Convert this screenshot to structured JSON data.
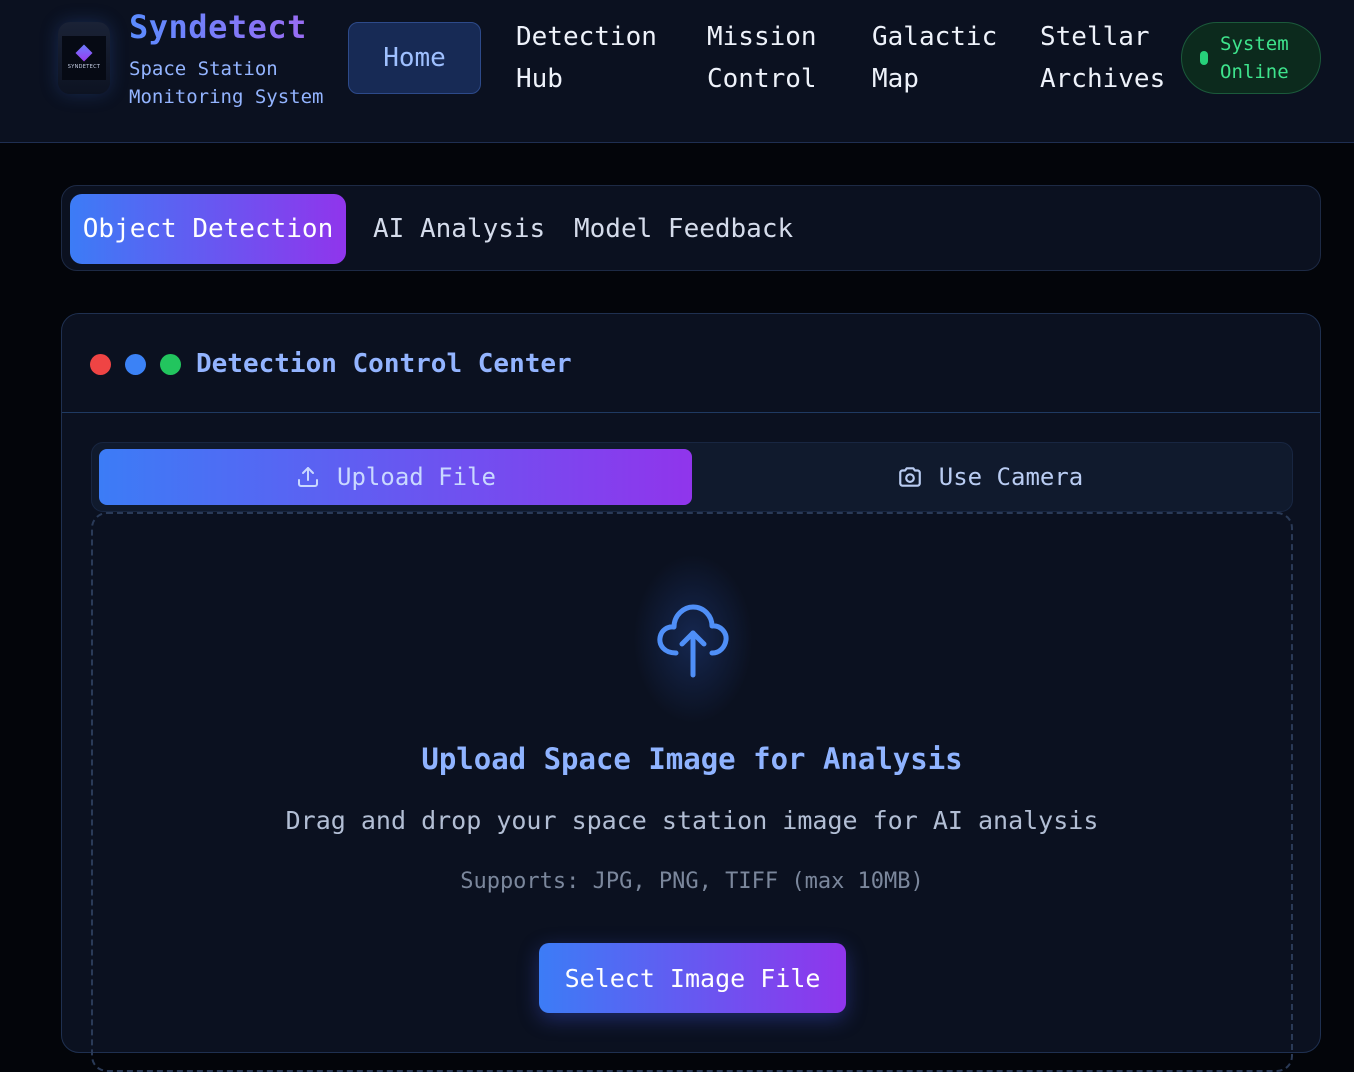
{
  "header": {
    "logo_text": "SYNDETECT",
    "brand_title": "Syndetect",
    "brand_subtitle": "Space Station Monitoring System",
    "nav": {
      "home": "Home",
      "detection_hub": "Detection Hub",
      "mission_control": "Mission Control",
      "galactic_map": "Galactic Map",
      "stellar_archives": "Stellar Archives"
    },
    "status": "System Online"
  },
  "tabs": {
    "object_detection": "Object Detection",
    "ai_analysis": "AI Analysis",
    "model_feedback": "Model Feedback"
  },
  "control_center": {
    "title": "Detection Control Center",
    "window_dots": [
      "#ef4444",
      "#3b82f6",
      "#22c55e"
    ],
    "mode": {
      "upload_label": "Upload File",
      "upload_icon": "upload-icon",
      "camera_label": "Use Camera",
      "camera_icon": "camera-icon"
    },
    "dropzone": {
      "icon": "cloud-upload-icon",
      "title": "Upload Space Image for Analysis",
      "description": "Drag and drop your space station image for AI analysis",
      "supported": "Supports: JPG, PNG, TIFF (max 10MB)",
      "button_label": "Select Image File"
    }
  },
  "colors": {
    "accent_gradient_start": "#3c7cf6",
    "accent_gradient_end": "#9035ec",
    "status_green": "#3ee38c",
    "brand_blue": "#93b4ff"
  }
}
